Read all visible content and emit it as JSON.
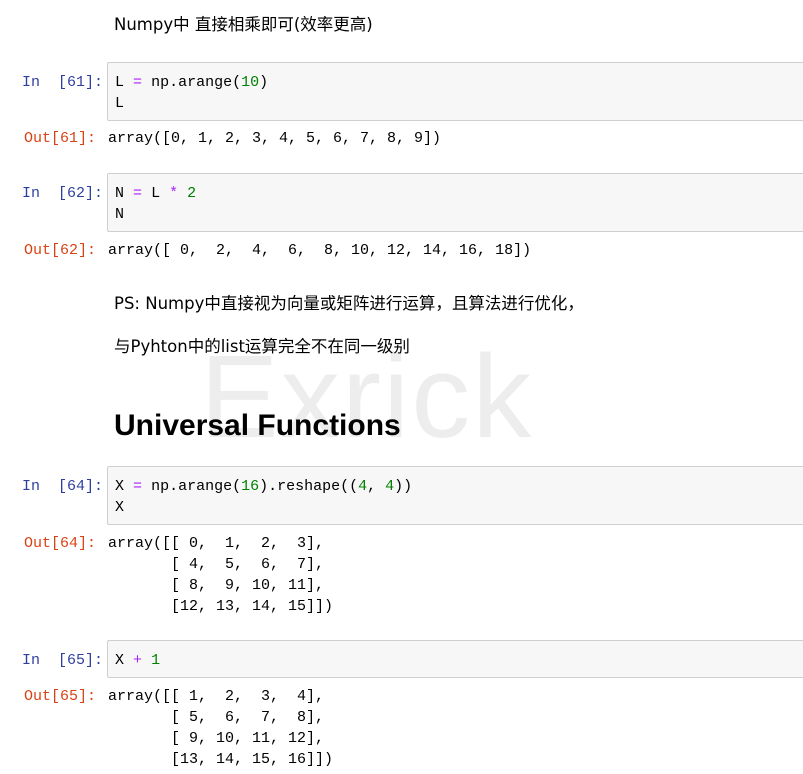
{
  "markdown": {
    "intro": "Numpy中 直接相乘即可(效率更高)",
    "ps_line1": "PS: Numpy中直接视为向量或矩阵进行运算，且算法进行优化，",
    "ps_line2": "与Pyhton中的list运算完全不在同一级别",
    "heading": "Universal Functions"
  },
  "watermark": "Exrick",
  "cells": [
    {
      "in_prompt": "In  [61]:",
      "code_line1_a": "L",
      "code_line1_op": "=",
      "code_line1_b": "np.arange(",
      "code_line1_num": "10",
      "code_line1_c": ")",
      "code_line2": "L",
      "out_prompt": "Out[61]:",
      "output": "array([0, 1, 2, 3, 4, 5, 6, 7, 8, 9])"
    },
    {
      "in_prompt": "In  [62]:",
      "code_line1_a": "N",
      "code_line1_op": "=",
      "code_line1_b": "L",
      "code_line1_op2": "*",
      "code_line1_num": "2",
      "code_line2": "N",
      "out_prompt": "Out[62]:",
      "output": "array([ 0,  2,  4,  6,  8, 10, 12, 14, 16, 18])"
    },
    {
      "in_prompt": "In  [64]:",
      "code_line1_a": "X",
      "code_line1_op": "=",
      "code_line1_b": "np.arange(",
      "code_line1_num": "16",
      "code_line1_c": ").reshape((",
      "code_line1_num2": "4",
      "code_line1_d": ", ",
      "code_line1_num3": "4",
      "code_line1_e": "))",
      "code_line2": "X",
      "out_prompt": "Out[64]:",
      "output": "array([[ 0,  1,  2,  3],\n       [ 4,  5,  6,  7],\n       [ 8,  9, 10, 11],\n       [12, 13, 14, 15]])"
    },
    {
      "in_prompt": "In  [65]:",
      "code_line1_a": "X",
      "code_line1_op": "+",
      "code_line1_num": "1",
      "out_prompt": "Out[65]:",
      "output": "array([[ 1,  2,  3,  4],\n       [ 5,  6,  7,  8],\n       [ 9, 10, 11, 12],\n       [13, 14, 15, 16]])"
    }
  ],
  "colors": {
    "in_prompt": "#303f9f",
    "out_prompt": "#d84315",
    "operator": "#aa22ff",
    "number": "#008000",
    "cell_background": "#f7f7f7",
    "cell_border": "#cfcfcf"
  }
}
